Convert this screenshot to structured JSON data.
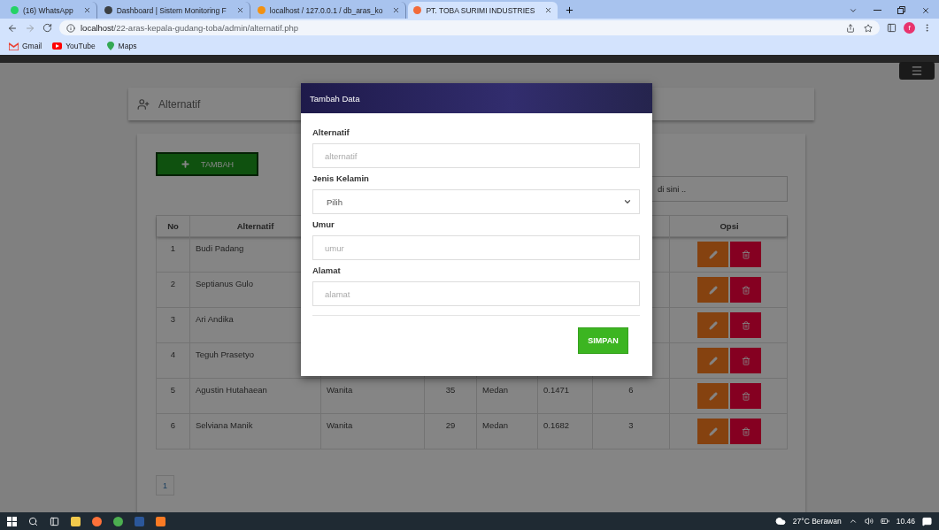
{
  "browser": {
    "tabs": [
      {
        "title": "(16) WhatsApp",
        "selected": false,
        "color": "#25d366"
      },
      {
        "title": "Dashboard | Sistem Monitoring F",
        "selected": false,
        "color": "#3c4043"
      },
      {
        "title": "localhost / 127.0.0.1 / db_aras_ko",
        "selected": false,
        "color": "#f29111"
      },
      {
        "title": "PT. TOBA SURIMI INDUSTRIES",
        "selected": true,
        "color": "#f26b3a"
      }
    ],
    "address": {
      "host": "localhost",
      "path": "/22-aras-kepala-gudang-toba/admin/alternatif.php"
    },
    "profile": "f",
    "bookmarks": [
      {
        "kind": "gmail",
        "label": "Gmail"
      },
      {
        "kind": "youtube",
        "label": "YouTube"
      },
      {
        "kind": "maps",
        "label": "Maps"
      }
    ]
  },
  "page": {
    "header": {
      "title": "Alternatif"
    },
    "add_button": "TAMBAH",
    "search": {
      "placeholder": "di sini .."
    },
    "table": {
      "columns": {
        "no": "No",
        "alternatif": "Alternatif",
        "opsi": "Opsi"
      },
      "rows": [
        {
          "no": "1",
          "alternatif": "Budi Padang"
        },
        {
          "no": "2",
          "alternatif": "Septianus Gulo"
        },
        {
          "no": "3",
          "alternatif": "Ari Andika"
        },
        {
          "no": "4",
          "alternatif": "Teguh Prasetyo"
        },
        {
          "no": "5",
          "alternatif": "Agustin Hutahaean",
          "jenis_kelamin": "Wanita",
          "umur": "35",
          "alamat": "Medan",
          "column_6": "0.1471",
          "column_7": "6"
        },
        {
          "no": "6",
          "alternatif": "Selviana Manik",
          "jenis_kelamin": "Wanita",
          "umur": "29",
          "alamat": "Medan",
          "column_6": "0.1682",
          "column_7": "3"
        }
      ]
    },
    "pagination": [
      "1"
    ]
  },
  "modal": {
    "title": "Tambah Data",
    "fields": [
      {
        "kind": "text",
        "label": "Alternatif",
        "placeholder": "alternatif"
      },
      {
        "kind": "select",
        "label": "Jenis Kelamin",
        "value": "Pilih"
      },
      {
        "kind": "text",
        "label": "Umur",
        "placeholder": "umur"
      },
      {
        "kind": "text",
        "label": "Alamat",
        "placeholder": "alamat"
      }
    ],
    "submit": "SIMPAN"
  },
  "taskbar": {
    "weather": "27°C Berawan",
    "time": "10.46"
  }
}
